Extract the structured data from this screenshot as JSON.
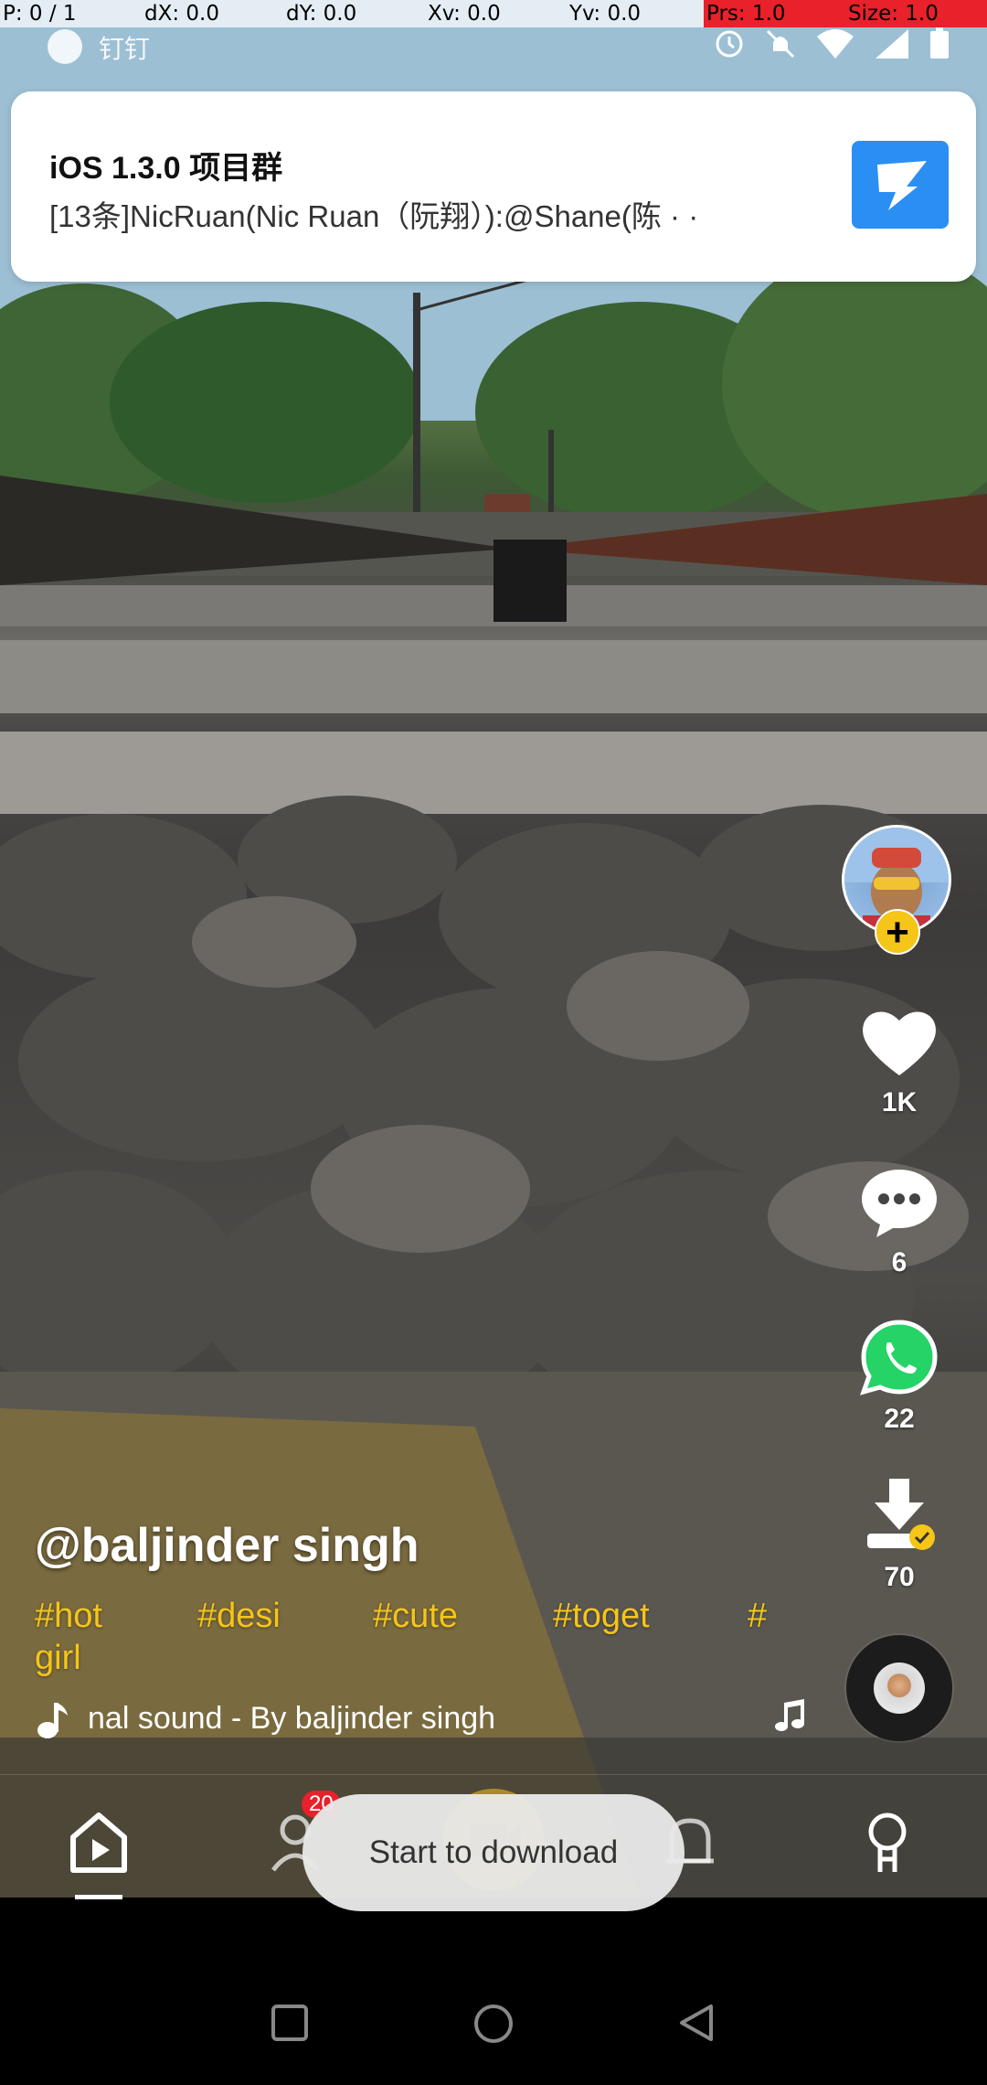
{
  "debug_bar": {
    "p": "P: 0 / 1",
    "dx": "dX: 0.0",
    "dy": "dY: 0.0",
    "xv": "Xv: 0.0",
    "yv": "Yv: 0.0",
    "prs": "Prs: 1.0",
    "size": "Size: 1.0"
  },
  "status_bar": {
    "app_name": "钉钉",
    "icons": [
      "alarm-icon",
      "mute-icon",
      "wifi-icon",
      "signal-icon",
      "battery-icon"
    ]
  },
  "notification": {
    "title": "iOS 1.3.0 项目群",
    "body": "[13条]NicRuan(Nic Ruan（阮翔）):@Shane(陈 · ·",
    "app_icon": "dingtalk-icon"
  },
  "video": {
    "username": "@baljinder singh",
    "hashtags": [
      "#hot",
      "#desi",
      "#cute",
      "#toget",
      "#",
      "girl"
    ],
    "sound_text": "nal sound - By baljinder singh"
  },
  "actions": {
    "likes": "1K",
    "comments": "6",
    "shares": "22",
    "downloads": "70"
  },
  "bottom_nav": {
    "badge": "20",
    "items": [
      "home-icon",
      "friends-icon",
      "create-icon",
      "notifications-icon",
      "profile-icon"
    ]
  },
  "toast": {
    "text": "Start to download"
  },
  "colors": {
    "accent_yellow": "#f5c518",
    "badge_red": "#e8212a",
    "dingtalk_blue": "#2b8ef2",
    "whatsapp_green": "#25d366"
  }
}
